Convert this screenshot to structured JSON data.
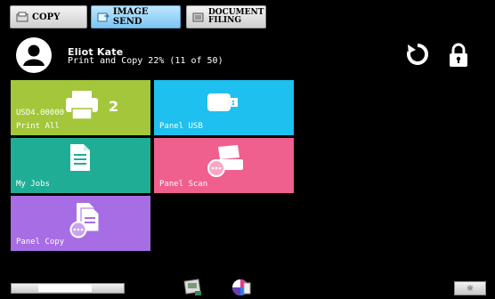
{
  "tabs": [
    {
      "label": "COPY",
      "icon": "copy-icon"
    },
    {
      "label": "IMAGE SEND",
      "icon": "image-send-icon"
    },
    {
      "label_line1": "DOCUMENT",
      "label_line2": "FILING",
      "icon": "document-filing-icon"
    }
  ],
  "user": {
    "name": "Eliot Kate",
    "usage": "Print and Copy  22% (11 of 50)"
  },
  "header_icons": [
    "refresh-icon",
    "lock-icon"
  ],
  "tiles": {
    "print_all": {
      "label": "Print All",
      "amount": "USD4.00000",
      "count": "2",
      "color": "#a3c63a",
      "icon": "printer-icon"
    },
    "panel_usb": {
      "label": "Panel USB",
      "color": "#1ec0ef",
      "icon": "usb-icon"
    },
    "my_jobs": {
      "label": "My Jobs",
      "color": "#1fae95",
      "icon": "document-icon"
    },
    "panel_scan": {
      "label": "Panel Scan",
      "color": "#f0608e",
      "icon": "scanner-icon"
    },
    "panel_copy": {
      "label": "Panel Copy",
      "color": "#a66de4",
      "icon": "copy-document-icon"
    }
  },
  "bottom": {
    "icons": [
      "job-status-icon",
      "color-mode-icon",
      "brightness-icon"
    ],
    "brightness_glyph": "☼"
  }
}
